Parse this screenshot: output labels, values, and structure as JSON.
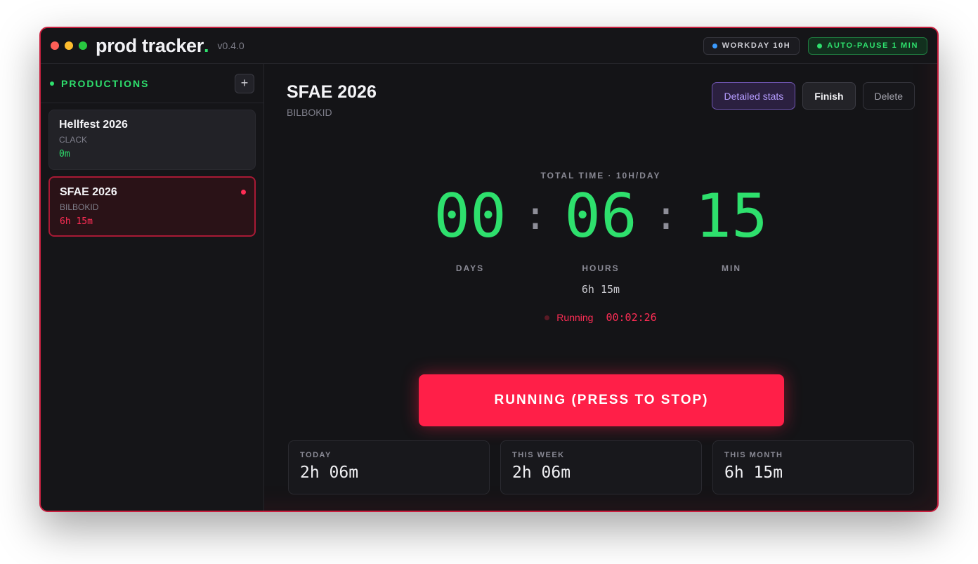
{
  "app": {
    "brand": "prod tracker",
    "brand_dot": ".",
    "version": "v0.4.0",
    "workday_badge": "WORKDAY 10H",
    "autopause_badge": "AUTO-PAUSE 1 MIN"
  },
  "sidebar": {
    "title": "PRODUCTIONS",
    "add_label": "+",
    "items": [
      {
        "name": "Hellfest 2026",
        "client": "CLACK",
        "time": "0m"
      },
      {
        "name": "SFAE 2026",
        "client": "BILBOKID",
        "time": "6h 15m"
      }
    ]
  },
  "main": {
    "title": "SFAE 2026",
    "client": "BILBOKID",
    "actions": {
      "stats": "Detailed stats",
      "finish": "Finish",
      "delete": "Delete"
    },
    "timer": {
      "label": "TOTAL TIME · 10H/DAY",
      "days": "00",
      "hours": "06",
      "minutes": "15",
      "sep": ":",
      "days_label": "DAYS",
      "hours_label": "HOURS",
      "minutes_label": "MIN",
      "total_text": "6h 15m",
      "running_label": "Running",
      "running_time": "00:02:26"
    },
    "stop_button": "RUNNING (PRESS TO STOP)",
    "stats": [
      {
        "label": "TODAY",
        "value": "2h 06m"
      },
      {
        "label": "THIS WEEK",
        "value": "2h 06m"
      },
      {
        "label": "THIS MONTH",
        "value": "6h 15m"
      }
    ]
  },
  "colors": {
    "accent_green": "#2ee06d",
    "accent_red": "#ff1f48",
    "accent_purple": "#b59cff",
    "background": "#141417"
  }
}
